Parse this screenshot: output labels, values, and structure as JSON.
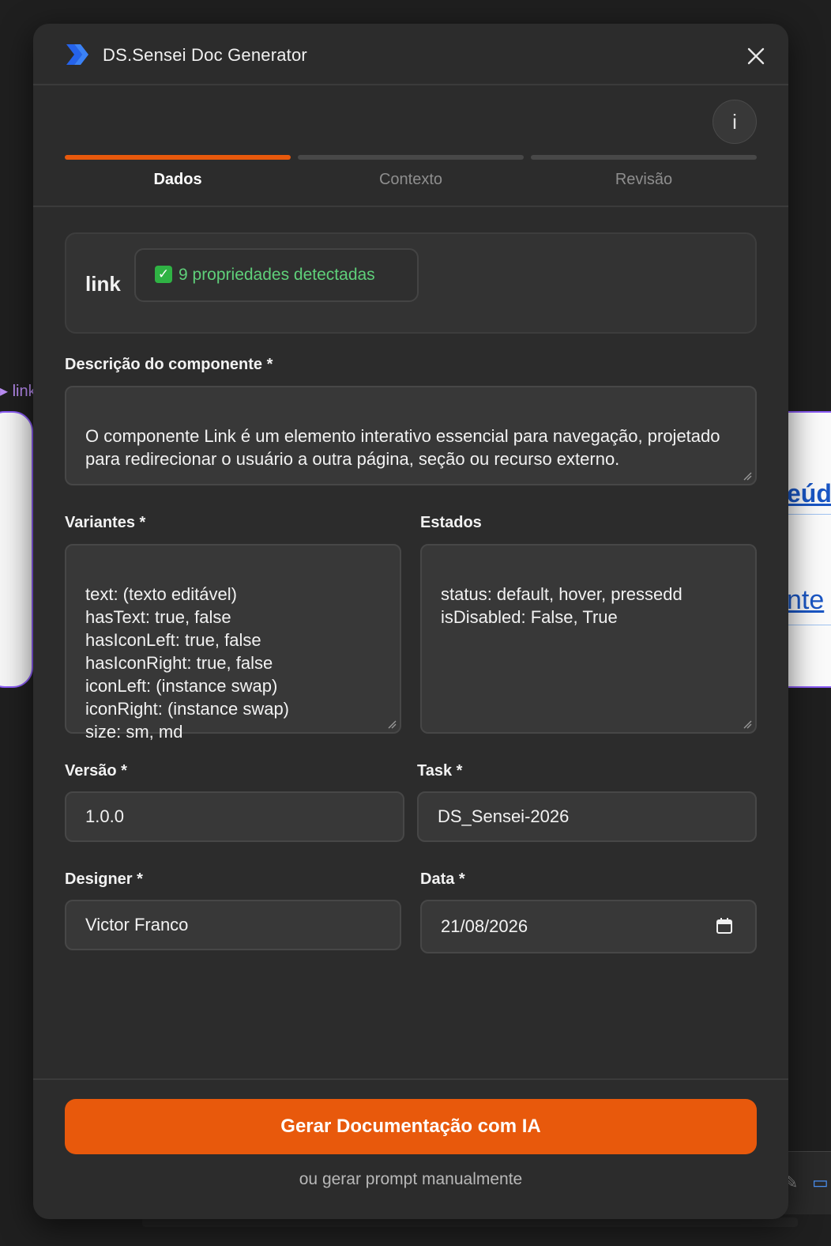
{
  "background": {
    "layer_label": "link",
    "right_text_1": "eúdo",
    "right_text_2": "nte"
  },
  "modal": {
    "title": "DS.Sensei Doc Generator",
    "info_label": "i"
  },
  "steps": [
    {
      "label": "Dados",
      "active": true
    },
    {
      "label": "Contexto",
      "active": false
    },
    {
      "label": "Revisão",
      "active": false
    }
  ],
  "component": {
    "name": "link",
    "props_badge": "9 propriedades detectadas"
  },
  "form": {
    "description": {
      "label": "Descrição do componente *",
      "value": "O componente Link é um elemento interativo essencial para navegação, projetado para redirecionar o usuário a outra página, seção ou recurso externo."
    },
    "variants": {
      "label": "Variantes *",
      "value": "text: (texto editável)\nhasText: true, false\nhasIconLeft: true, false\nhasIconRight: true, false\niconLeft: (instance swap)\niconRight: (instance swap)\nsize: sm, md"
    },
    "states": {
      "label": "Estados",
      "value": "status: default, hover, pressedd\nisDisabled: False, True"
    },
    "version": {
      "label": "Versão *",
      "value": "1.0.0"
    },
    "task": {
      "label": "Task *",
      "value": "DS_Sensei-2026"
    },
    "designer": {
      "label": "Designer *",
      "value": "Victor Franco"
    },
    "date": {
      "label": "Data *",
      "value": "21/08/2026"
    }
  },
  "actions": {
    "generate_label": "Gerar Documentação com IA",
    "manual_label": "ou gerar prompt manualmente"
  },
  "colors": {
    "accent": "#e8590c",
    "success": "#5fd07a",
    "background": "#2c2c2c"
  },
  "icons": [
    "ds-sensei-logo-icon",
    "close-icon",
    "info-icon",
    "check-icon",
    "calendar-icon",
    "resize-grip-icon"
  ]
}
